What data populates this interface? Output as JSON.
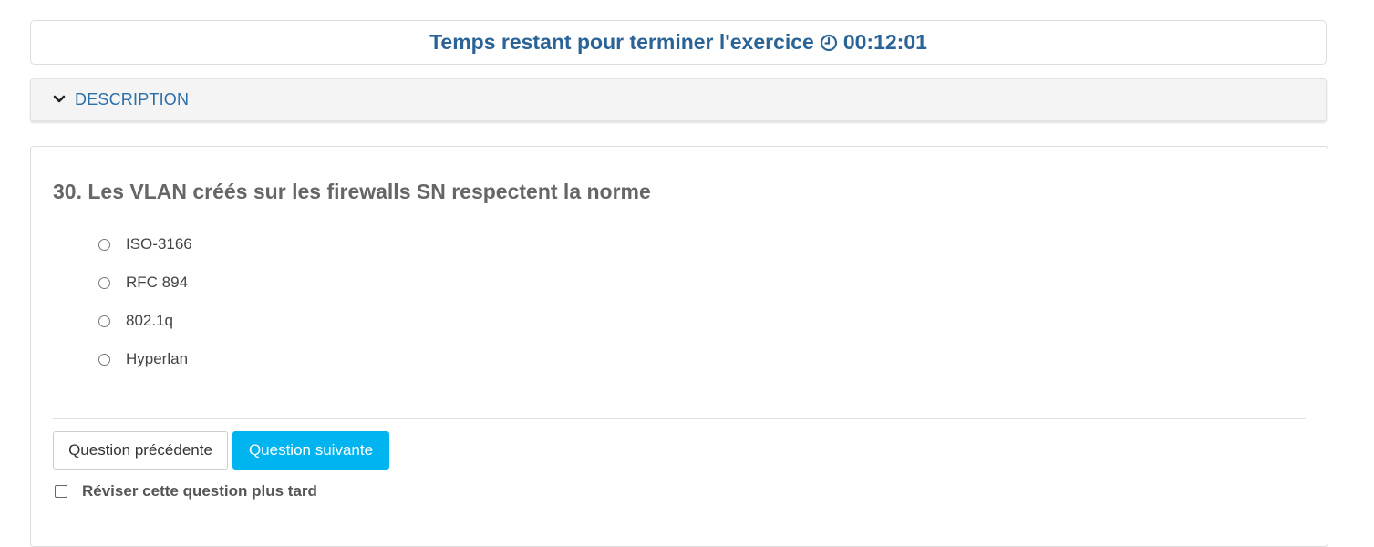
{
  "timer": {
    "label": "Temps restant pour terminer l'exercice",
    "icon": "clock-icon",
    "value": "00:12:01",
    "color": "#2a6496"
  },
  "description": {
    "icon": "chevron-down-icon",
    "label": "DESCRIPTION",
    "color": "#2a6fa8"
  },
  "question": {
    "title": "30. Les VLAN créés sur les firewalls SN respectent la norme",
    "options": [
      {
        "label": "ISO-3166",
        "selected": false
      },
      {
        "label": "RFC 894",
        "selected": false
      },
      {
        "label": "802.1q",
        "selected": false
      },
      {
        "label": "Hyperlan",
        "selected": false
      }
    ]
  },
  "navigation": {
    "prev_label": "Question précédente",
    "next_label": "Question suivante",
    "next_color": "#00b4f0"
  },
  "review": {
    "label": "Réviser cette question plus tard",
    "checked": false
  }
}
